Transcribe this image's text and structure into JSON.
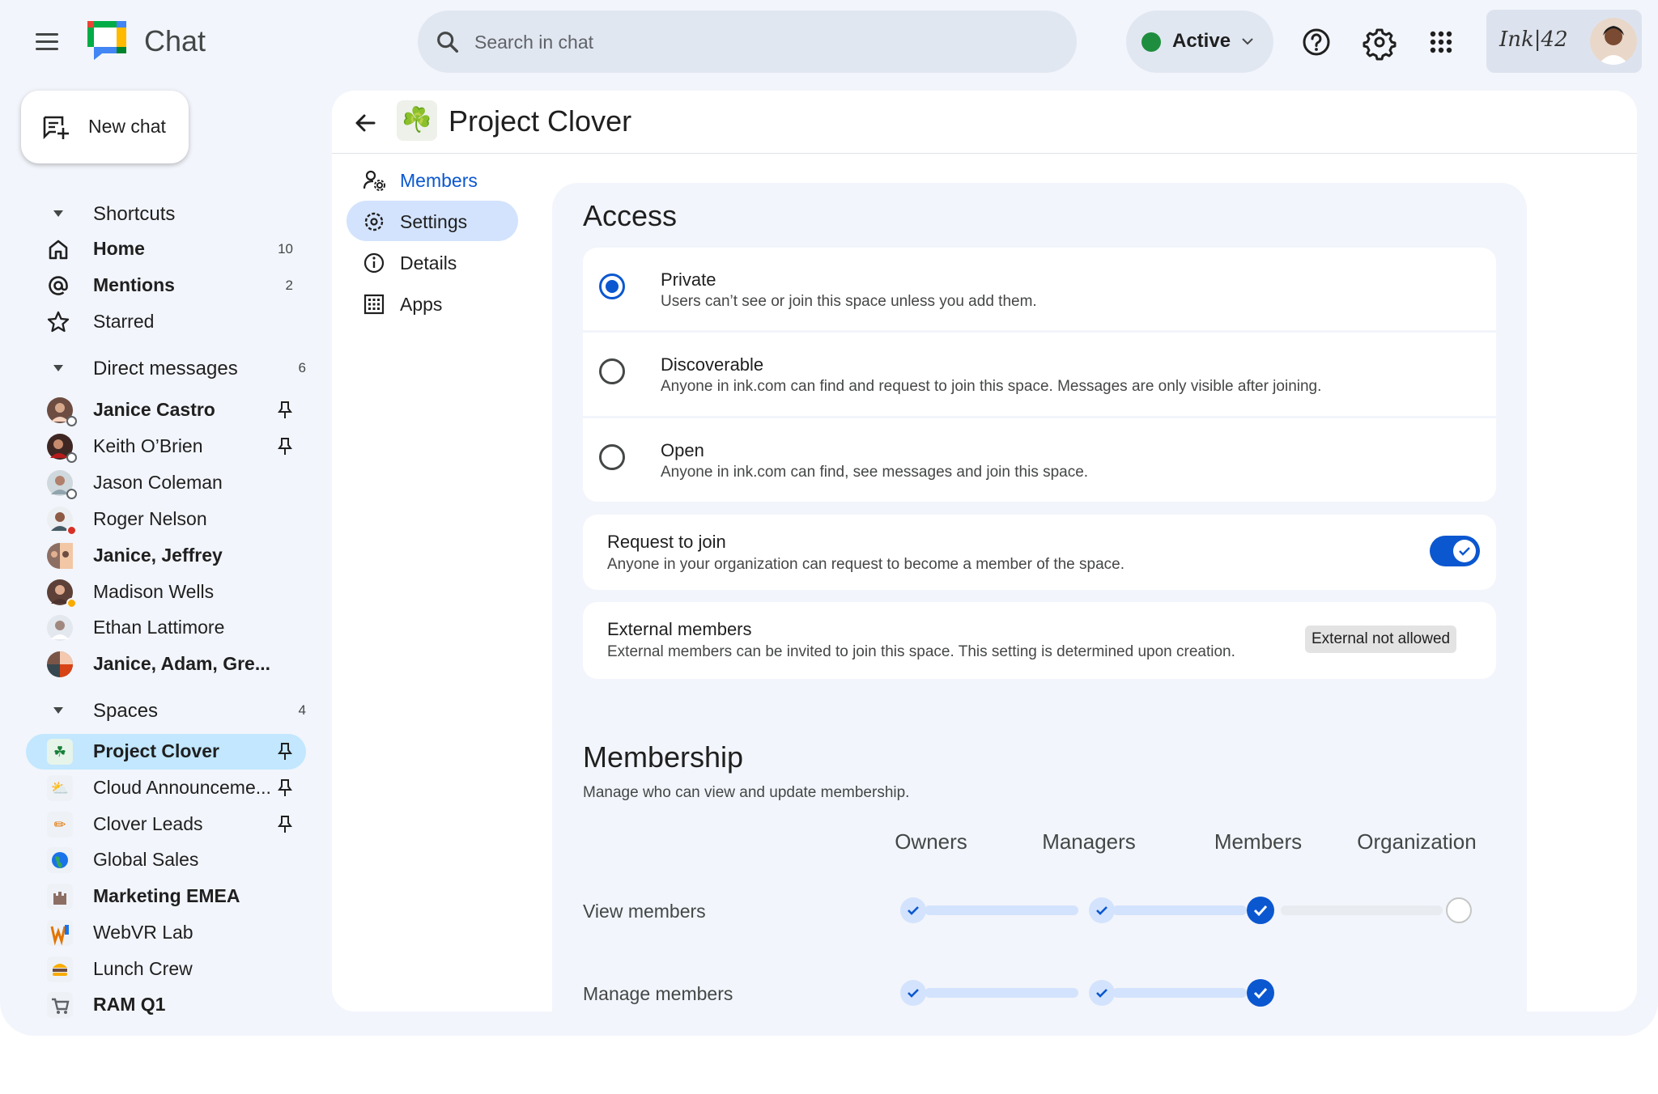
{
  "app": {
    "name": "Chat",
    "brand_colors": {
      "green": "#00ac47",
      "blue": "#4285f4",
      "yellow": "#ffba00",
      "red": "#ea4335"
    }
  },
  "search": {
    "placeholder": "Search in chat"
  },
  "status": {
    "label": "Active",
    "color": "#1e8e3e"
  },
  "account": {
    "brand": "Ink|42"
  },
  "icons": {
    "help": "help-icon",
    "settings": "gear-icon",
    "apps": "apps-grid-icon"
  },
  "sidebar": {
    "new_chat_label": "New chat",
    "shortcuts": {
      "label": "Shortcuts",
      "items": [
        {
          "label": "Home",
          "count": "10",
          "icon": "home-icon"
        },
        {
          "label": "Mentions",
          "count": "2",
          "icon": "at-icon"
        },
        {
          "label": "Starred",
          "count": "",
          "icon": "star-icon"
        }
      ]
    },
    "direct_messages": {
      "label": "Direct messages",
      "count": "6",
      "items": [
        {
          "label": "Janice Castro",
          "bold": true,
          "pinned": true
        },
        {
          "label": "Keith O’Brien",
          "bold": false,
          "pinned": true
        },
        {
          "label": "Jason Coleman",
          "bold": false,
          "pinned": false
        },
        {
          "label": "Roger Nelson",
          "bold": false,
          "pinned": false
        },
        {
          "label": "Janice, Jeffrey",
          "bold": true,
          "pinned": false
        },
        {
          "label": "Madison Wells",
          "bold": false,
          "pinned": false
        },
        {
          "label": "Ethan Lattimore",
          "bold": false,
          "pinned": false
        },
        {
          "label": "Janice, Adam, Gre...",
          "bold": true,
          "pinned": false
        }
      ]
    },
    "spaces": {
      "label": "Spaces",
      "count": "4",
      "items": [
        {
          "label": "Project Clover",
          "bold": true,
          "pinned": true,
          "selected": true,
          "emoji": "☘"
        },
        {
          "label": "Cloud Announceme...",
          "bold": false,
          "pinned": true,
          "emoji": "⛅"
        },
        {
          "label": "Clover Leads",
          "bold": false,
          "pinned": true,
          "emoji": "✏"
        },
        {
          "label": "Global Sales",
          "bold": false,
          "pinned": false,
          "emoji": "🌏"
        },
        {
          "label": "Marketing EMEA",
          "bold": true,
          "pinned": false,
          "emoji": "🏰"
        },
        {
          "label": "WebVR Lab",
          "bold": false,
          "pinned": false,
          "emoji": "W"
        },
        {
          "label": "Lunch Crew",
          "bold": false,
          "pinned": false,
          "emoji": "🍔"
        },
        {
          "label": "RAM Q1",
          "bold": true,
          "pinned": false,
          "emoji": "🛒"
        }
      ]
    }
  },
  "space": {
    "title": "Project Clover",
    "emoji": "☘️",
    "nav": [
      {
        "label": "Members",
        "icon": "members-gear-icon"
      },
      {
        "label": "Settings",
        "icon": "gear-icon",
        "selected": true
      },
      {
        "label": "Details",
        "icon": "info-icon"
      },
      {
        "label": "Apps",
        "icon": "apps-icon"
      }
    ]
  },
  "access": {
    "title": "Access",
    "options": [
      {
        "title": "Private",
        "desc": "Users can’t see or join this space unless you add them.",
        "checked": true
      },
      {
        "title": "Discoverable",
        "desc": "Anyone in ink.com can find and request to join this space. Messages are only visible after joining.",
        "checked": false
      },
      {
        "title": "Open",
        "desc": "Anyone in ink.com can find, see messages and join this space.",
        "checked": false
      }
    ],
    "request_to_join": {
      "title": "Request to join",
      "desc": "Anyone in your organization can request to become a member of the space.",
      "enabled": true
    },
    "external_members": {
      "title": "External members",
      "desc": "External members can be invited to join this space. This setting is determined upon creation.",
      "badge": "External not allowed"
    }
  },
  "membership": {
    "title": "Membership",
    "subtitle": "Manage who can view and update membership.",
    "columns": [
      "Owners",
      "Managers",
      "Members",
      "Organization"
    ],
    "rows": [
      {
        "label": "View members",
        "level": "Members"
      },
      {
        "label": "Manage members",
        "level": "Members"
      }
    ]
  }
}
